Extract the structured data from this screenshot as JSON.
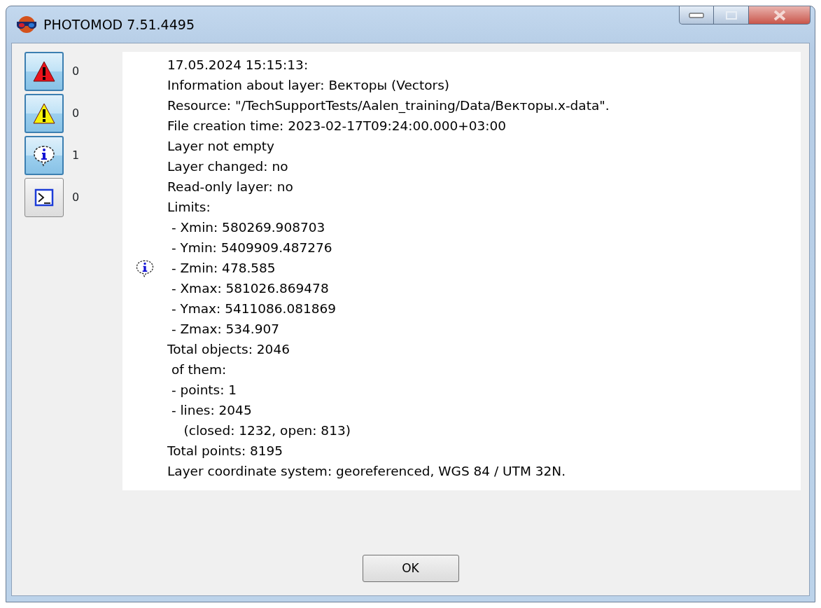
{
  "window": {
    "title": "PHOTOMOD 7.51.4495"
  },
  "filters": [
    {
      "kind": "error",
      "pressed": true,
      "count": "0"
    },
    {
      "kind": "warning",
      "pressed": true,
      "count": "0"
    },
    {
      "kind": "info",
      "pressed": true,
      "count": "1"
    },
    {
      "kind": "console",
      "pressed": false,
      "count": "0"
    }
  ],
  "messages": [
    {
      "kind": "info",
      "lines": [
        "17.05.2024 15:15:13:",
        "Information about layer: Векторы (Vectors)",
        "Resource: \"/TechSupportTests/Aalen_training/Data/Векторы.x-data\".",
        "File creation time: 2023-02-17T09:24:00.000+03:00",
        "Layer not empty",
        "Layer changed: no",
        "Read-only layer: no",
        "Limits:",
        " - Xmin: 580269.908703",
        " - Ymin: 5409909.487276",
        " - Zmin: 478.585",
        " - Xmax: 581026.869478",
        " - Ymax: 5411086.081869",
        " - Zmax: 534.907",
        "Total objects: 2046",
        " of them:",
        " - points: 1",
        " - lines: 2045",
        "    (closed: 1232, open: 813)",
        "Total points: 8195",
        "Layer coordinate system: georeferenced, WGS 84 / UTM 32N."
      ]
    }
  ],
  "buttons": [
    "OK"
  ]
}
